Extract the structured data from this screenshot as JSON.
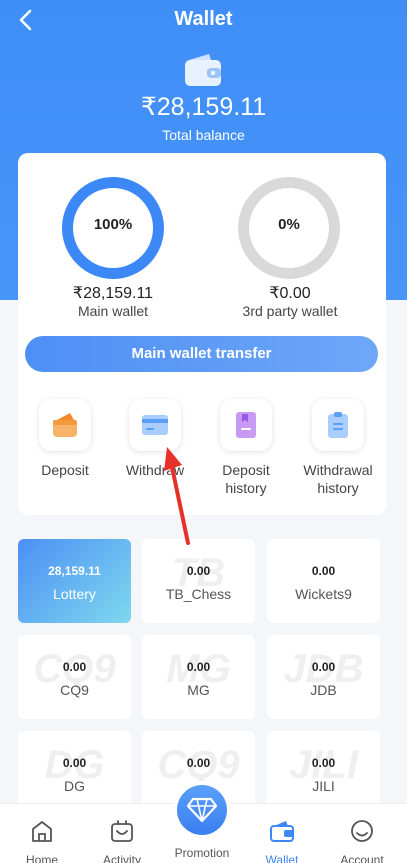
{
  "header": {
    "title": "Wallet",
    "balance": "₹28,159.11",
    "balance_label": "Total balance",
    "icon": "wallet-icon"
  },
  "card": {
    "main": {
      "percent": "100%",
      "percent_value": 100,
      "amount": "₹28,159.11",
      "label": "Main wallet"
    },
    "third": {
      "percent": "0%",
      "percent_value": 0,
      "amount": "₹0.00",
      "label": "3rd party wallet"
    },
    "transfer_label": "Main wallet transfer",
    "actions": [
      {
        "label": "Deposit",
        "icon": "deposit-icon"
      },
      {
        "label": "Withdraw",
        "icon": "withdraw-card-icon"
      },
      {
        "label": "Deposit history",
        "icon": "deposit-history-icon"
      },
      {
        "label": "Withdrawal history",
        "icon": "withdrawal-history-icon"
      }
    ]
  },
  "games": [
    {
      "value": "28,159.11",
      "name": "Lottery",
      "active": true
    },
    {
      "value": "0.00",
      "name": "TB_Chess"
    },
    {
      "value": "0.00",
      "name": "Wickets9"
    },
    {
      "value": "0.00",
      "name": "CQ9"
    },
    {
      "value": "0.00",
      "name": "MG"
    },
    {
      "value": "0.00",
      "name": "JDB"
    },
    {
      "value": "0.00",
      "name": "DG"
    },
    {
      "value": "0.00",
      "name": ""
    },
    {
      "value": "0.00",
      "name": "JILI"
    }
  ],
  "nav": {
    "items": [
      {
        "label": "Home",
        "icon": "home-icon"
      },
      {
        "label": "Activity",
        "icon": "activity-icon"
      },
      {
        "label": "Promotion",
        "icon": "diamond-icon"
      },
      {
        "label": "Wallet",
        "icon": "wallet-icon",
        "active": true
      },
      {
        "label": "Account",
        "icon": "account-icon"
      }
    ]
  },
  "colors": {
    "accent": "#3b88f6",
    "ring_empty": "#d9d9d9",
    "arrow": "#e8302a"
  }
}
